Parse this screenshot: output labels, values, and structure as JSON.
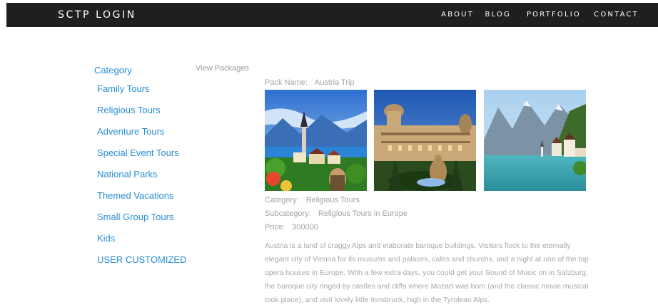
{
  "header": {
    "brand": "SCTP LOGIN",
    "nav": [
      "ABOUT",
      "BLOG",
      "PORTFOLIO",
      "CONTACT"
    ]
  },
  "sidebar": {
    "title": "Category",
    "items": [
      "Family Tours",
      "Religious Tours",
      "Adventure Tours",
      "Special Event Tours",
      "National Parks",
      "Themed Vacations",
      "Small Group Tours",
      "Kids",
      "USER CUSTOMIZED"
    ]
  },
  "main": {
    "view_packages": "View Packages",
    "pack_name_label": "Pack Name:",
    "pack_name": "Austria Trip",
    "photos": [
      "hallstatt-village-photo",
      "vienna-palace-photo",
      "alpine-lake-photo"
    ],
    "category_label": "Category:",
    "category": "Religious Tours",
    "subcategory_label": "Subcategory:",
    "subcategory": "Religious Tours in Europe",
    "price_label": "Price:",
    "price": "300000",
    "description": "Austria is a land of craggy Alps and elaborate baroque buildings. Visitors flock to the eternally elegant city of Vienna for its musums and palaces, cafes and churchs, and a night at one of the top opera houses in Europe. With a few extra days, you could get your Sound of Music on in Salzburg, the baroque city ringed by castles and cliffs where Mozart was born (and the classic movie musical took place), and visit lovely little Innsbruck, high in the Tyrolean Alps."
  },
  "colors": {
    "header_bg": "#1f1f1f",
    "link_blue": "#2a8fd6",
    "muted_text": "#a3a3a3"
  }
}
